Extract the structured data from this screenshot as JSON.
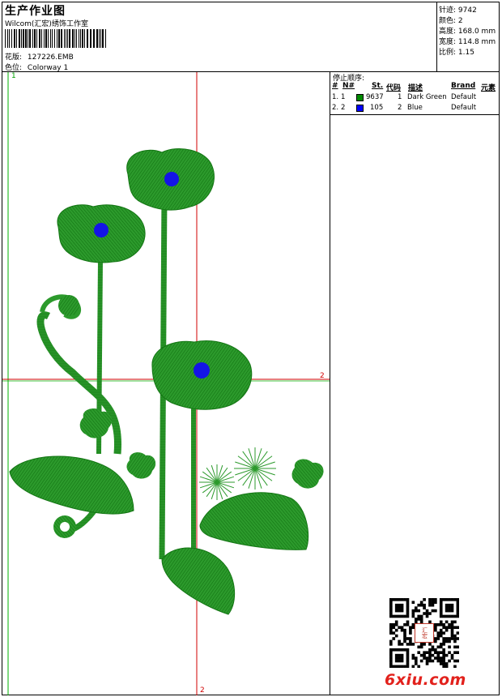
{
  "header": {
    "title": "生产作业图",
    "studio": "Wilcom(汇宏)绣饰工作室",
    "design_label": "花版:",
    "design_value": "127226.EMB",
    "colorway_label": "色位:",
    "colorway_value": "Colorway 1"
  },
  "stats": {
    "stitches_label": "针迹:",
    "stitches_value": "9742",
    "colors_label": "颜色:",
    "colors_value": "2",
    "height_label": "高度:",
    "height_value": "168.0 mm",
    "width_label": "宽度:",
    "width_value": "114.8 mm",
    "scale_label": "比例:",
    "scale_value": "1.15"
  },
  "stop_sequence": {
    "title": "停止顺序:",
    "columns": [
      "#",
      "N#",
      "St.",
      "代码",
      "描述",
      "Brand",
      "元素"
    ],
    "rows": [
      {
        "idx": "1.",
        "n": "1",
        "color": "#008a00",
        "st": "9637",
        "code": "1",
        "desc": "Dark Green",
        "brand": "Default"
      },
      {
        "idx": "2.",
        "n": "2",
        "color": "#0000ff",
        "st": "105",
        "code": "2",
        "desc": "Blue",
        "brand": "Default"
      }
    ]
  },
  "axes": {
    "top_left": "1",
    "right_mark": "2",
    "bottom_mark": "2"
  },
  "colors": {
    "thread_green": "#1e8c1e",
    "thread_blue": "#1414e6",
    "guide_red": "#d10000",
    "guide_green": "#00b000"
  },
  "watermark": "6xiu.com",
  "qr_stamp_text": "汇宏"
}
